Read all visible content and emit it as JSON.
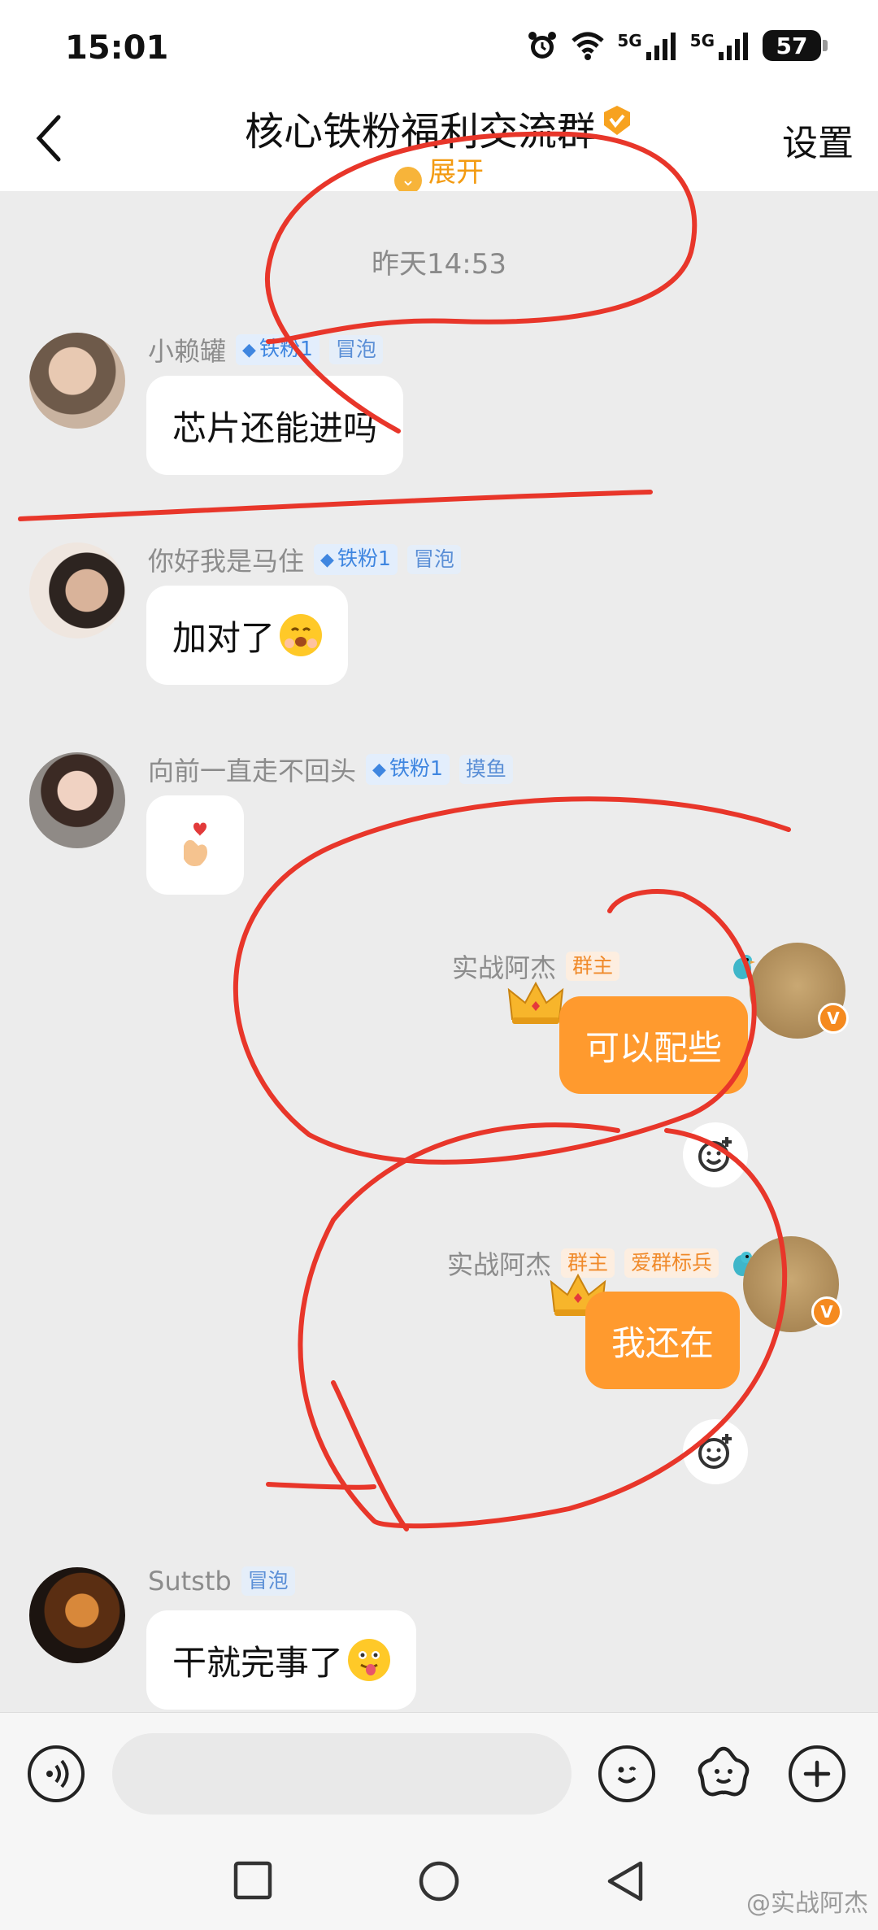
{
  "status_bar": {
    "time": "15:01",
    "network_1": "5G",
    "network_2": "5G",
    "battery": "57"
  },
  "header": {
    "title": "核心铁粉福利交流群",
    "expand_label": "展开",
    "settings_label": "设置"
  },
  "chat": {
    "timestamp": "昨天14:53",
    "messages": [
      {
        "sender": "小赖罐",
        "tags": [
          "铁粉1",
          "冒泡"
        ],
        "text": "芯片还能进吗"
      },
      {
        "sender": "你好我是马住",
        "tags": [
          "铁粉1",
          "冒泡"
        ],
        "text": "加对了"
      },
      {
        "sender": "向前一直走不回头",
        "tags": [
          "铁粉1",
          "摸鱼"
        ],
        "text": ""
      },
      {
        "sender": "实战阿杰",
        "tags": [
          "群主"
        ],
        "text": "可以配些",
        "own": true
      },
      {
        "sender": "实战阿杰",
        "tags": [
          "群主",
          "爱群标兵"
        ],
        "text": "我还在",
        "own": true
      },
      {
        "sender": "Sutstb",
        "tags": [
          "冒泡"
        ],
        "text": "干就完事了"
      }
    ]
  },
  "colors": {
    "accent_orange": "#ff9a2e",
    "annotation_red": "#e8362a",
    "chat_background": "#ececec"
  },
  "watermark": "@实战阿杰"
}
